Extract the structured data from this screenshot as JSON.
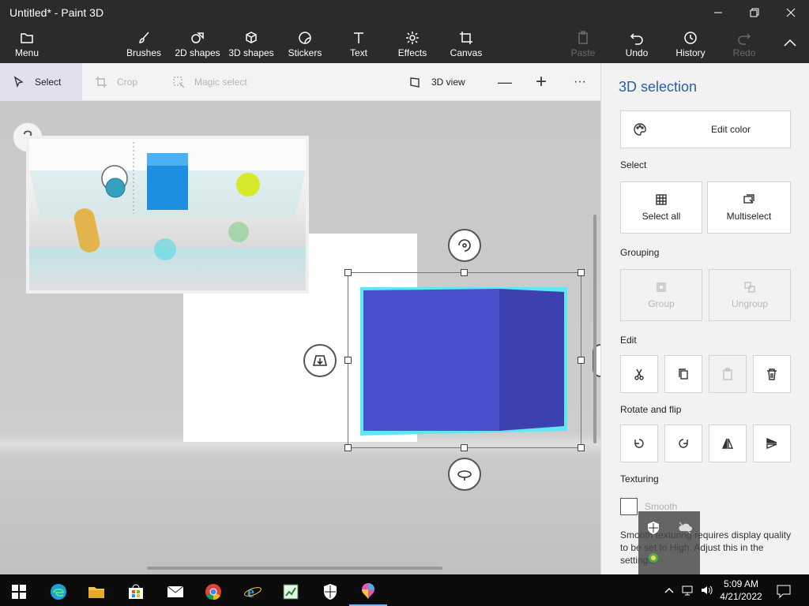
{
  "window": {
    "title": "Untitled* - Paint 3D",
    "controls": [
      "minimize-icon",
      "maximize-icon",
      "close-icon"
    ]
  },
  "ribbon": {
    "menu": "Menu",
    "tools": [
      {
        "label": "Brushes",
        "icon": "brush-icon"
      },
      {
        "label": "2D shapes",
        "icon": "2d-shapes-icon"
      },
      {
        "label": "3D shapes",
        "icon": "3d-shapes-icon"
      },
      {
        "label": "Stickers",
        "icon": "sticker-icon"
      },
      {
        "label": "Text",
        "icon": "text-icon"
      },
      {
        "label": "Effects",
        "icon": "effects-icon"
      },
      {
        "label": "Canvas",
        "icon": "canvas-icon"
      }
    ],
    "actions": {
      "paste": "Paste",
      "undo": "Undo",
      "history": "History",
      "redo": "Redo"
    }
  },
  "toolbar": {
    "select": "Select",
    "crop": "Crop",
    "magic_select": "Magic select",
    "view_3d": "3D view",
    "zoom_out": "—",
    "zoom_in": "+",
    "more": "···"
  },
  "canvas": {
    "help": "?"
  },
  "panel": {
    "title": "3D selection",
    "edit_color": "Edit color",
    "select_section": "Select",
    "select_all": "Select all",
    "multiselect": "Multiselect",
    "grouping_section": "Grouping",
    "group": "Group",
    "ungroup": "Ungroup",
    "edit_section": "Edit",
    "rotate_section": "Rotate and flip",
    "texturing_section": "Texturing",
    "smooth": "Smooth",
    "smooth_note": "Smooth texturing requires display quality to be set to High. Adjust this in the settings."
  },
  "taskbar": {
    "time": "5:09 AM",
    "date": "4/21/2022"
  },
  "colors": {
    "dark_chrome": "#2b2b2b",
    "accent_blue": "#2a5ea8",
    "cube_front": "#4a4fcc",
    "cube_side": "#3d41b0",
    "selection_glow": "#5ee8f4"
  }
}
